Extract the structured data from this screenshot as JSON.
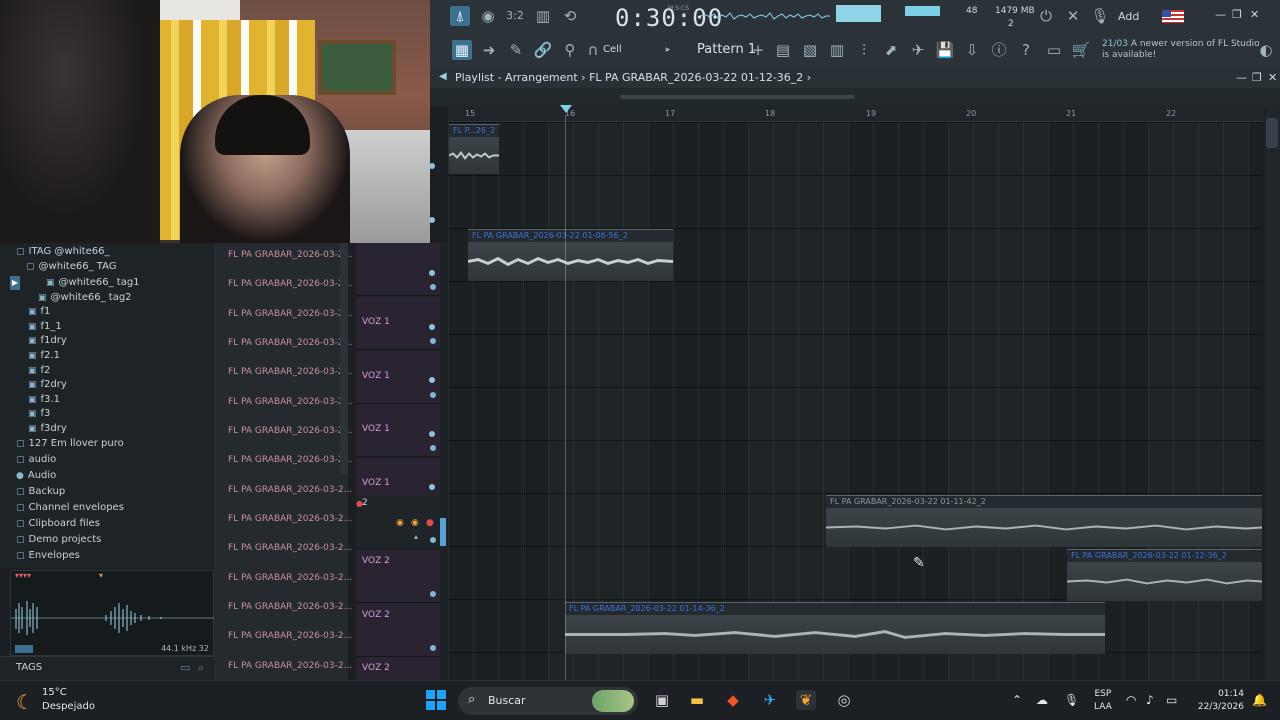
{
  "toolbar": {
    "time": "0:30:00",
    "time_unit": "M:S:CS",
    "cpu": "48",
    "memory": "1479 MB",
    "voices": "2",
    "add_label": "Add",
    "pattern": "Pattern 1",
    "snap": "Cell",
    "notice_count": "21/03",
    "notice_text_1": "A newer version of FL Studio",
    "notice_text_2": "is available!"
  },
  "playlist": {
    "title": "Playlist - Arrangement",
    "project": "FL PA GRABAR_2026-03-22 01-12-36_2",
    "bars": [
      "15",
      "16",
      "17",
      "18",
      "19",
      "20",
      "21",
      "22"
    ]
  },
  "browser": {
    "items": [
      {
        "label": "ITAG @white66_",
        "icon": "folder"
      },
      {
        "label": "@white66_ TAG",
        "icon": "folder"
      },
      {
        "label": "@white66_ tag1",
        "icon": "file"
      },
      {
        "label": "@white66_ tag2",
        "icon": "file"
      },
      {
        "label": "f1",
        "icon": "file"
      },
      {
        "label": "f1_1",
        "icon": "file"
      },
      {
        "label": "f1dry",
        "icon": "file"
      },
      {
        "label": "f2.1",
        "icon": "file"
      },
      {
        "label": "f2",
        "icon": "file"
      },
      {
        "label": "f2dry",
        "icon": "file"
      },
      {
        "label": "f3.1",
        "icon": "file"
      },
      {
        "label": "f3",
        "icon": "file"
      },
      {
        "label": "f3dry",
        "icon": "file"
      },
      {
        "label": "127 Em llover puro",
        "icon": "folder"
      },
      {
        "label": "audio",
        "icon": "folder"
      },
      {
        "label": "Audio",
        "icon": "person"
      },
      {
        "label": "Backup",
        "icon": "folder"
      },
      {
        "label": "Channel envelopes",
        "icon": "folder"
      },
      {
        "label": "Clipboard files",
        "icon": "folder"
      },
      {
        "label": "Demo projects",
        "icon": "folder"
      },
      {
        "label": "Envelopes",
        "icon": "folder"
      }
    ],
    "sample_info": "44.1 kHz 32",
    "tags_label": "TAGS"
  },
  "tracks": {
    "names": [
      "FL PA GRABAR_2026-03-2...",
      "FL PA GRABAR_2026-03-2...",
      "FL PA GRABAR_2026-03-2...",
      "FL PA GRABAR_2026-03-2...",
      "FL PA GRABAR_2026-03-2...",
      "FL PA GRABAR_2026-03-2...",
      "FL PA GRABAR_2026-03-2...",
      "FL PA GRABAR_2026-03-2...",
      "FL PA GRABAR_2026-03-2...",
      "FL PA GRABAR_2026-03-2...",
      "FL PA GRABAR_2026-03-2...",
      "FL PA GRABAR_2026-03-2...",
      "FL PA GRABAR_2026-03-2...",
      "FL PA GRABAR_2026-03-2...",
      "FL PA GRABAR_2026-03-2..."
    ],
    "headers": [
      "VOZ 1",
      "VOZ 1",
      "VOZ 1",
      "VOZ 1",
      "2",
      "VOZ 2",
      "VOZ 2",
      "VOZ 2"
    ]
  },
  "clips": [
    {
      "label": "FL P...26_2"
    },
    {
      "label": "FL PA GRABAR_2026-03-22 01-06-56_2"
    },
    {
      "label": "FL PA GRABAR_2026-03-22 01-11-42_2"
    },
    {
      "label": "FL PA GRABAR_2026-03-22 01-12-36_2"
    },
    {
      "label": "FL PA GRABAR_2026-03-22 01-14-36_2"
    }
  ],
  "taskbar": {
    "weather_temp": "15°C",
    "weather_desc": "Despejado",
    "search_placeholder": "Buscar",
    "lang_1": "ESP",
    "lang_2": "LAA",
    "time": "01:14",
    "date": "22/3/2026"
  }
}
